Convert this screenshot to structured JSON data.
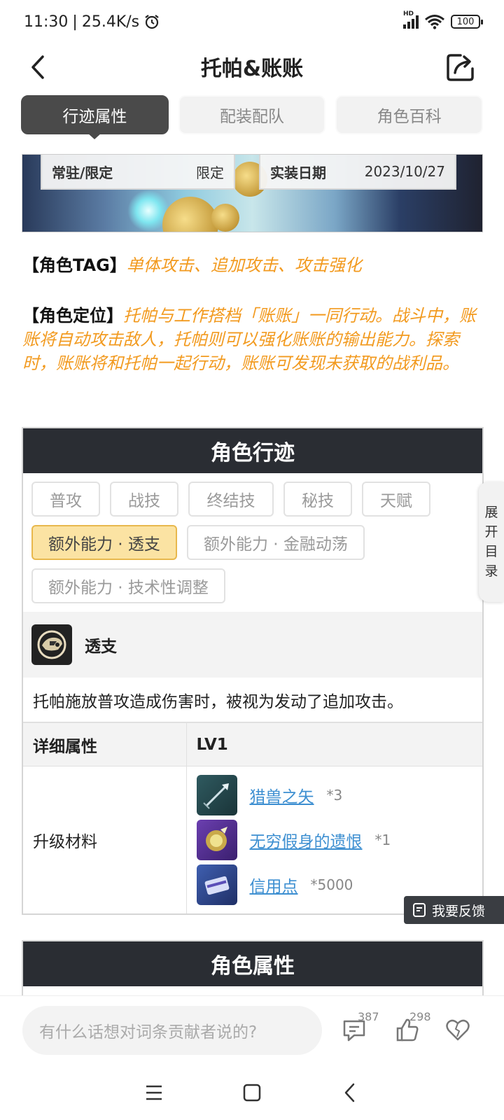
{
  "status_bar": {
    "time": "11:30",
    "speed": "25.4K/s",
    "battery": "100",
    "network_label": "HD"
  },
  "header": {
    "title": "托帕&账账"
  },
  "tabs": [
    {
      "label": "行迹属性",
      "active": true
    },
    {
      "label": "配装配队",
      "active": false
    },
    {
      "label": "角色百科",
      "active": false
    }
  ],
  "banner": {
    "availability_label": "常驻/限定",
    "availability_value": "限定",
    "release_label": "实装日期",
    "release_value": "2023/10/27"
  },
  "tag": {
    "label": "【角色TAG】",
    "value": "单体攻击、追加攻击、攻击强化"
  },
  "role": {
    "label": "【角色定位】",
    "value": "托帕与工作搭档「账账」一同行动。战斗中，账账将自动攻击敌人，托帕则可以强化账账的输出能力。探索时，账账将和托帕一起行动，账账可发现未获取的战利品。"
  },
  "traces": {
    "title": "角色行迹",
    "chips": [
      {
        "label": "普攻",
        "active": false
      },
      {
        "label": "战技",
        "active": false
      },
      {
        "label": "终结技",
        "active": false
      },
      {
        "label": "秘技",
        "active": false
      },
      {
        "label": "天赋",
        "active": false
      },
      {
        "label": "额外能力 · 透支",
        "active": true
      },
      {
        "label": "额外能力 · 金融动荡",
        "active": false
      },
      {
        "label": "额外能力 · 技术性调整",
        "active": false
      }
    ],
    "skill_name": "透支",
    "skill_desc": "托帕施放普攻造成伤害时，被视为发动了追加攻击。",
    "attr_header_left": "详细属性",
    "attr_header_right": "LV1",
    "material_label": "升级材料",
    "materials": [
      {
        "name": "猎兽之矢",
        "count": "*3"
      },
      {
        "name": "无穷假身的遗恨",
        "count": "*1"
      },
      {
        "name": "信用点",
        "count": "*5000"
      }
    ]
  },
  "attributes_section": {
    "title": "角色属性"
  },
  "side_toc": {
    "chars": [
      "展",
      "开",
      "目",
      "录"
    ]
  },
  "feedback": {
    "label": "我要反馈"
  },
  "bottom_bar": {
    "placeholder": "有什么话想对词条贡献者说的?",
    "comment_count": "387",
    "like_count": "298"
  },
  "colors": {
    "accent_orange": "#f29a1f",
    "link_blue": "#3d8fd1",
    "dark_header": "#2a2d33",
    "active_chip": "#fbe3a3"
  }
}
